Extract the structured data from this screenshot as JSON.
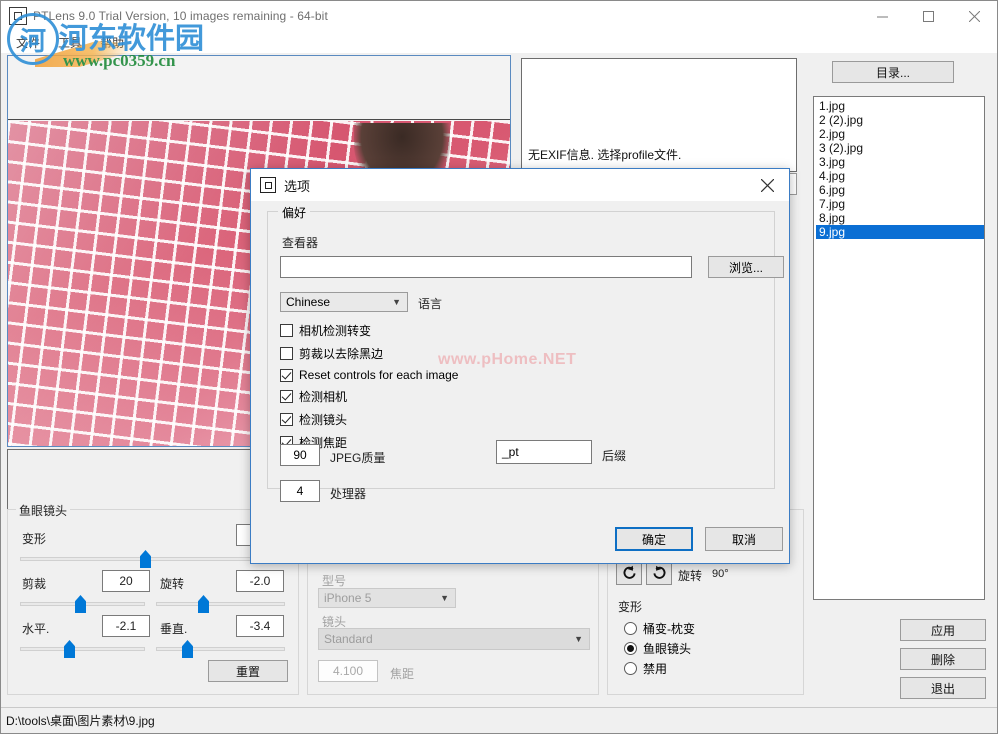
{
  "window": {
    "title": "PTLens 9.0 Trial Version, 10 images remaining - 64-bit",
    "icon": "app-square-icon",
    "minimize": "–",
    "maximize": "□",
    "close": "✕"
  },
  "menubar": {
    "items": [
      {
        "label": "文件"
      },
      {
        "label": "工具"
      },
      {
        "label": "帮助"
      }
    ]
  },
  "watermark": {
    "logo_letter": "河",
    "site_cn": "河东软件园",
    "site_url": "www.pc0359.cn",
    "secondary": "www.pHome.NET"
  },
  "exif": {
    "message": "无EXIF信息. 选择profile文件.",
    "dropdown_value": ""
  },
  "files": {
    "directory_button": "目录...",
    "items": [
      {
        "name": "1.jpg",
        "selected": false
      },
      {
        "name": "2 (2).jpg",
        "selected": false
      },
      {
        "name": "2.jpg",
        "selected": false
      },
      {
        "name": "3 (2).jpg",
        "selected": false
      },
      {
        "name": "3.jpg",
        "selected": false
      },
      {
        "name": "4.jpg",
        "selected": false
      },
      {
        "name": "6.jpg",
        "selected": false
      },
      {
        "name": "7.jpg",
        "selected": false
      },
      {
        "name": "8.jpg",
        "selected": false
      },
      {
        "name": "9.jpg",
        "selected": true
      }
    ]
  },
  "right_buttons": {
    "apply": "应用",
    "delete": "删除",
    "exit": "退出"
  },
  "fisheye": {
    "title": "鱼眼镜头",
    "distortion_label": "变形",
    "distortion_value": "",
    "crop_label": "剪裁",
    "crop_value": "20",
    "rotate_label": "旋转",
    "rotate_value": "-2.0",
    "horizontal_label": "水平.",
    "horizontal_value": "-2.1",
    "vertical_label": "垂直.",
    "vertical_value": "-3.4",
    "reset_button": "重置"
  },
  "camera": {
    "model_label": "型号",
    "model_value": "iPhone 5",
    "lens_label": "镜头",
    "lens_value": "Standard",
    "focal_value": "4.100",
    "focal_label": "焦距"
  },
  "transform": {
    "rotate_label": "旋转",
    "rotate_degrees": "90°",
    "rotate_ccw_icon": "rotate-counterclockwise-icon",
    "rotate_cw_icon": "rotate-clockwise-icon",
    "group_label": "变形",
    "options": [
      {
        "label": "桶变-枕变",
        "selected": false
      },
      {
        "label": "鱼眼镜头",
        "selected": true
      },
      {
        "label": "禁用",
        "selected": false
      }
    ]
  },
  "statusbar": {
    "path": "D:\\tools\\桌面\\图片素材\\9.jpg"
  },
  "dialog": {
    "title": "选项",
    "icon": "app-square-icon",
    "close": "✕",
    "group_title": "偏好",
    "viewer_label": "查看器",
    "viewer_value": "",
    "browse_button": "浏览...",
    "language_value": "Chinese",
    "language_label": "语言",
    "checkboxes": [
      {
        "label": "相机检测转变",
        "checked": false
      },
      {
        "label": "剪裁以去除黑边",
        "checked": false
      },
      {
        "label": "Reset controls for each image",
        "checked": true
      },
      {
        "label": "检测相机",
        "checked": true
      },
      {
        "label": "检测镜头",
        "checked": true
      },
      {
        "label": "检测焦距",
        "checked": true
      }
    ],
    "jpeg_quality_value": "90",
    "jpeg_quality_label": "JPEG质量",
    "suffix_value": "_pt",
    "suffix_label": "后缀",
    "processors_value": "4",
    "processors_label": "处理器",
    "ok_button": "确定",
    "cancel_button": "取消"
  },
  "colors": {
    "accent": "#0b6fd4",
    "dialog_border": "#3b7cc4",
    "slider": "#0078d7"
  }
}
